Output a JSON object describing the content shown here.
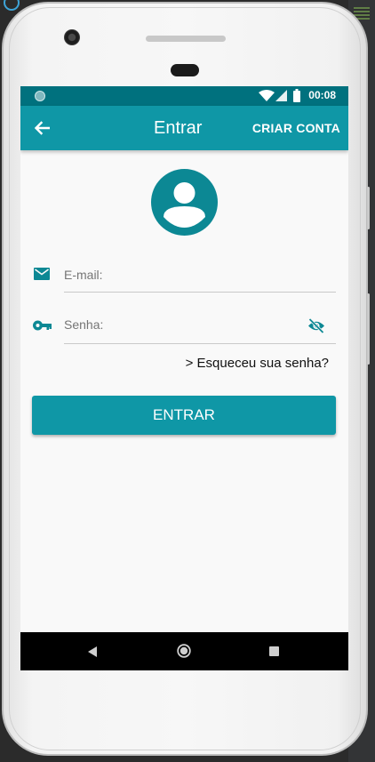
{
  "status_bar": {
    "time": "00:08"
  },
  "toolbar": {
    "title": "Entrar",
    "action_label": "CRIAR CONTA"
  },
  "form": {
    "email_placeholder": "E-mail:",
    "password_placeholder": "Senha:",
    "forgot_password_label": "> Esqueceu sua senha?",
    "submit_label": "ENTRAR"
  },
  "icons": {
    "back": "arrow-left-icon",
    "avatar": "account-circle-icon",
    "email": "email-icon",
    "password": "key-icon",
    "visibility": "eye-off-icon"
  },
  "colors": {
    "primary": "#0f97a6",
    "status_bar": "#00717e",
    "icon": "#0c8894",
    "background": "#f9f9f9"
  }
}
